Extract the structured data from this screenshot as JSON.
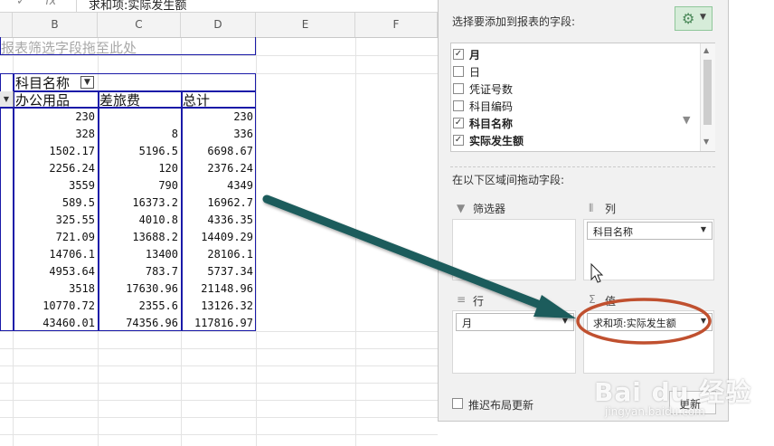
{
  "formula_bar": {
    "check_icon": "✓",
    "fx_label": "fx",
    "content": "求和项:实际发生额"
  },
  "sheet": {
    "columns": [
      "B",
      "C",
      "D",
      "E",
      "F"
    ],
    "hint_text": "报表筛选字段拖至此处",
    "pivot": {
      "column_field_label": "科目名称",
      "column_headers": [
        "办公用品",
        "差旅费",
        "总计"
      ],
      "rows": [
        [
          "230",
          "",
          "230"
        ],
        [
          "328",
          "8",
          "336"
        ],
        [
          "1502.17",
          "5196.5",
          "6698.67"
        ],
        [
          "2256.24",
          "120",
          "2376.24"
        ],
        [
          "3559",
          "790",
          "4349"
        ],
        [
          "589.5",
          "16373.2",
          "16962.7"
        ],
        [
          "325.55",
          "4010.8",
          "4336.35"
        ],
        [
          "721.09",
          "13688.2",
          "14409.29"
        ],
        [
          "14706.1",
          "13400",
          "28106.1"
        ],
        [
          "4953.64",
          "783.7",
          "5737.34"
        ],
        [
          "3518",
          "17630.96",
          "21148.96"
        ],
        [
          "10770.72",
          "2355.6",
          "13126.32"
        ],
        [
          "43460.01",
          "74356.96",
          "117816.97"
        ]
      ]
    }
  },
  "pivot_pane": {
    "title": "选择要添加到报表的字段:",
    "fields": [
      {
        "label": "月",
        "checked": true,
        "bold": true
      },
      {
        "label": "日",
        "checked": false,
        "bold": false
      },
      {
        "label": "凭证号数",
        "checked": false,
        "bold": false
      },
      {
        "label": "科目编码",
        "checked": false,
        "bold": false
      },
      {
        "label": "科目名称",
        "checked": true,
        "bold": true
      },
      {
        "label": "实际发生额",
        "checked": true,
        "bold": true
      }
    ],
    "areas_title": "在以下区域间拖动字段:",
    "zones": {
      "filters": {
        "label": "筛选器",
        "icon": "filter-icon"
      },
      "columns": {
        "label": "列",
        "icon": "columns-icon",
        "pill": "科目名称"
      },
      "rows": {
        "label": "行",
        "icon": "rows-icon",
        "pill": "月"
      },
      "values": {
        "label": "值",
        "icon": "sigma-icon",
        "pill": "求和项:实际发生额"
      }
    },
    "defer_label": "推迟布局更新",
    "update_label": "更新"
  },
  "watermark": {
    "main": "Bai du 经验",
    "sub": "jingyan.baidu.com"
  },
  "colors": {
    "pivot_border": "#1a1aa8",
    "arrow": "#1f5c5c",
    "highlight_ring": "#c0502f",
    "gear_bg": "#d6ecd9"
  }
}
